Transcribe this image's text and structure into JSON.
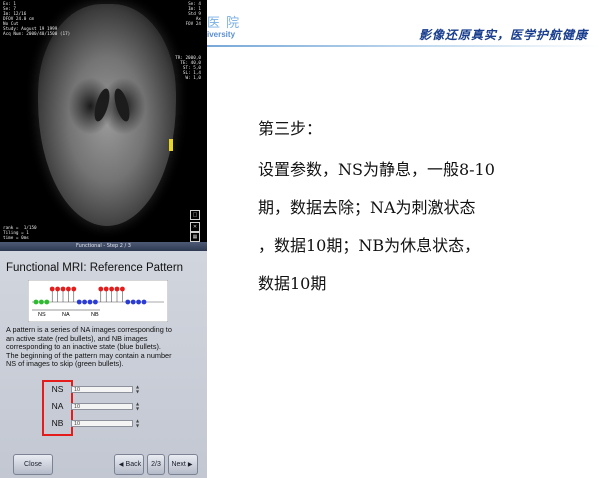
{
  "mri_overlay": {
    "top_left": "Ex: 1\nSe: 7\nIm: 12/16\nDFOV 24.0 cm\nNo Cut\nStudy: August 19 1999\nAcq Num: 2000/40/1500 (17)",
    "top_right": "Se: 4\nIm: 1\nStd 9\nAx\nFOV 24",
    "mid_right": "TR: 2000,0\nTE: 40,0\nST: 5,0\nSL: 1,4\nW: 1,0",
    "bottom_left": "rank =  1/150\nTiling = 1\ntime = 0ms"
  },
  "panel": {
    "title": "Functional - Step 2 / 3",
    "heading": "Functional MRI: Reference Pattern",
    "diagram_labels": [
      "NS",
      "NA",
      "NB"
    ],
    "description": [
      "A pattern is a series of NA images corresponding to",
      "an active state (red bullets), and NB images",
      "corresponding to an inactive state (blue bullets).",
      "The beginning of the pattern may contain a number",
      "NS of images to skip (green bullets)."
    ],
    "params": [
      {
        "label": "NS",
        "value": "10"
      },
      {
        "label": "NA",
        "value": "10"
      },
      {
        "label": "NB",
        "value": "10"
      }
    ],
    "buttons": {
      "close": "Close",
      "back": "Back",
      "page": "2/3",
      "next": "Next"
    }
  },
  "slide": {
    "hospital": "医 院",
    "university": "iversity",
    "slogan": "影像还原真实，医学护航健康",
    "lines": [
      "第三步：",
      "设置参数，NS为静息，一般8-10",
      "期，数据去除；NA为刺激状态",
      "，数据10期；NB为休息状态，",
      "数据10期"
    ]
  },
  "colors": {
    "highlight": "#e41c1c",
    "active": "#e41c1c",
    "inactive": "#2a3bd6",
    "skip": "#2bbd2b",
    "slogan": "#1a3e8e"
  }
}
